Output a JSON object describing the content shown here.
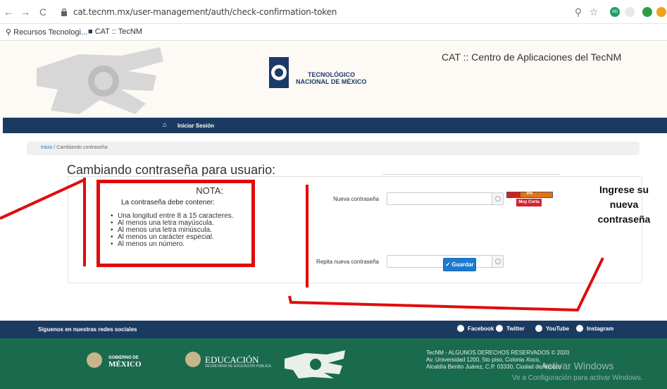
{
  "browser": {
    "url": "cat.tecnm.mx/user-management/auth/check-confirmation-token",
    "bookmarks": [
      {
        "label": "Recursos Tecnologi..."
      },
      {
        "label": "CAT :: TecNM"
      }
    ],
    "extension_badge": "AD"
  },
  "header": {
    "center_logo_line1": "TECNOLÓGICO",
    "center_logo_line2": "NACIONAL DE MÉXICO",
    "app_title": "CAT :: Centro de Aplicaciones del TecNM"
  },
  "nav": {
    "login_label": "Iniciar Sesión"
  },
  "breadcrumb": {
    "home": "Inicio",
    "separator": "/",
    "current": "Cambiando contraseña"
  },
  "page": {
    "title": "Cambiando contraseña para usuario:"
  },
  "nota": {
    "title": "NOTA:",
    "subtitle": "La contraseña debe contener:",
    "rules": [
      "Una longitud entre 8 a 15 caracteres.",
      "Al menos una letra mayúscula.",
      "Al menos una letra minúscula.",
      "Al menos un carácter especial.",
      "Al menos un número."
    ]
  },
  "form": {
    "new_password_label": "Nueva contraseña",
    "new_password_value": "",
    "repeat_password_label": "Repita nueva contraseña",
    "repeat_password_value": "",
    "strength_percent": "0%",
    "strength_fraction": 0.3,
    "strength_label": "Muy Corta",
    "save_label": "Guardar"
  },
  "annotation": {
    "line1": "Ingrese su",
    "line2": "nueva",
    "line3": "contraseña"
  },
  "footer": {
    "social_prompt": "Síguenos en nuestras redes sociales",
    "social": [
      "Facebook",
      "Twitter",
      "YouTube",
      "Instagram"
    ],
    "gob_line1": "GOBIERNO DE",
    "gob_line2": "MÉXICO",
    "edu_title": "EDUCACIÓN",
    "edu_subtitle": "SECRETARÍA DE EDUCACIÓN PÚBLICA",
    "rights": "TecNM - ALGUNOS DERECHOS RESERVADOS © 2020",
    "address1": "Av. Universidad 1200, 5to piso, Colonia Xoco,",
    "address2": "Alcaldía Benito Juárez, C.P. 03330, Ciudad de México",
    "win_title": "Activar Windows",
    "win_sub": "Ve a Configuración para activar Windows."
  },
  "colors": {
    "navy": "#1b3a62",
    "footer_green": "#1a6a4e",
    "annotation_red": "#e00c0c",
    "save_blue": "#1b7bd0"
  }
}
